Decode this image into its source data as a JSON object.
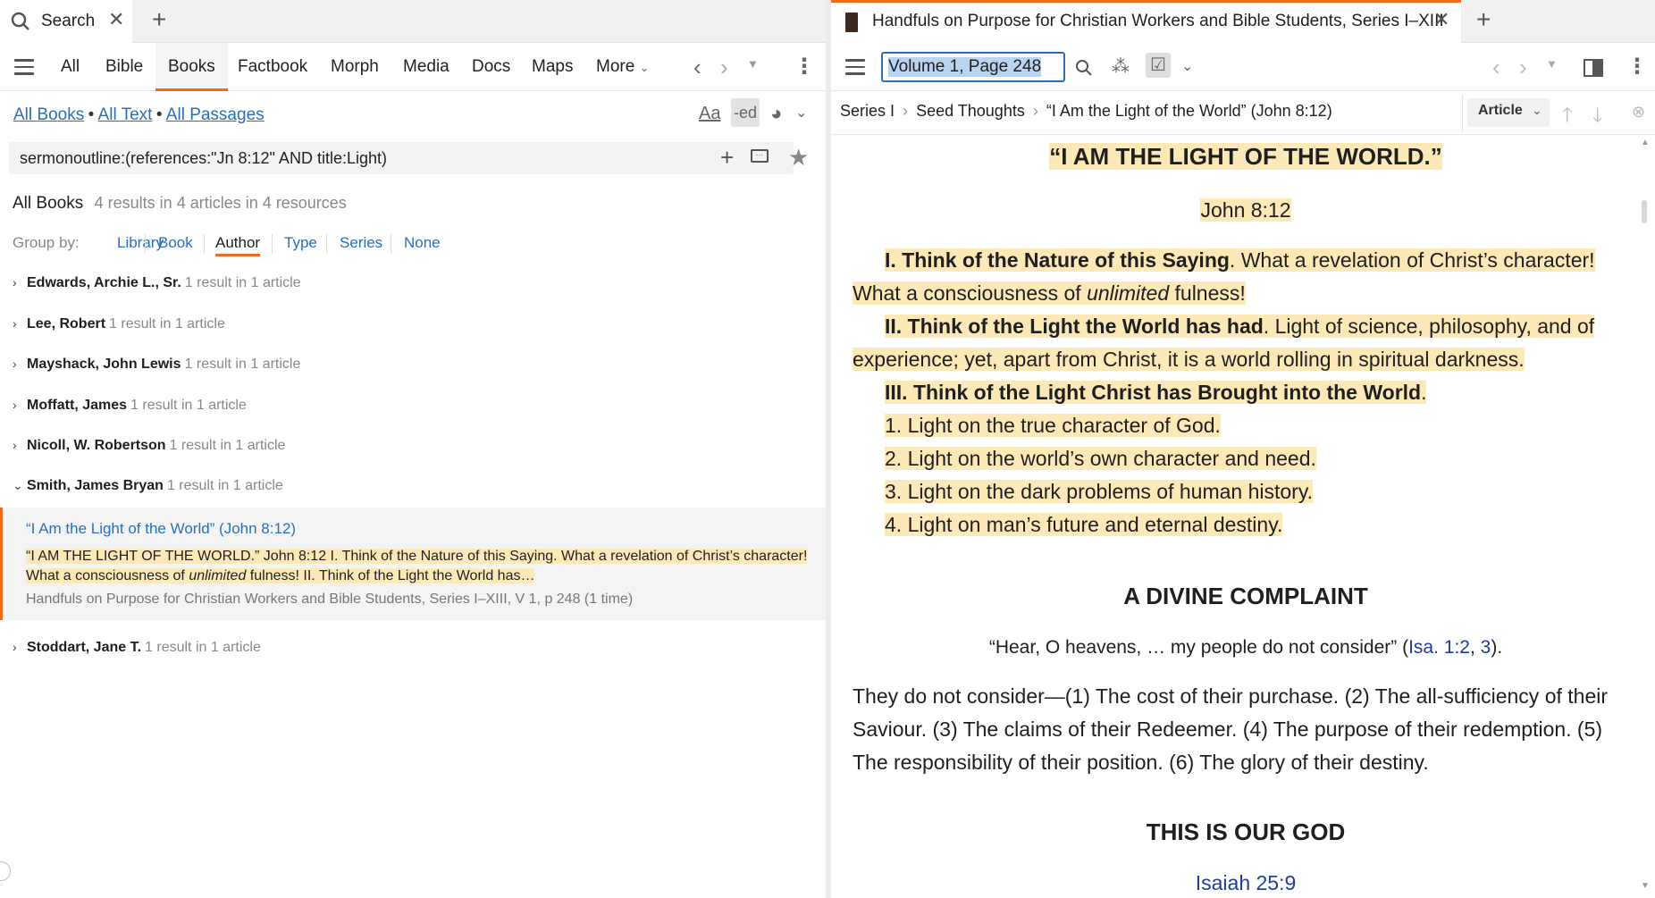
{
  "left": {
    "tab": {
      "title": "Search"
    },
    "toolbar": {
      "items": [
        "All",
        "Bible",
        "Books",
        "Factbook",
        "Morph",
        "Media",
        "Docs",
        "Maps",
        "More"
      ],
      "active": "Books"
    },
    "scope": {
      "all_books": "All Books",
      "all_text": "All Text",
      "all_passages": "All Passages"
    },
    "query": "sermonoutline:(references:\"Jn 8:12\" AND title:Light)",
    "summary": {
      "label": "All Books",
      "count": "4 results in 4 articles in 4 resources"
    },
    "group_by": {
      "label": "Group by:",
      "options": [
        "Library",
        "Book",
        "Author",
        "Type",
        "Series",
        "None"
      ],
      "active": "Author"
    },
    "authors": [
      {
        "name": "Edwards, Archie L., Sr.",
        "meta": "1 result in 1 article"
      },
      {
        "name": "Lee, Robert",
        "meta": "1 result in 1 article"
      },
      {
        "name": "Mayshack, John Lewis",
        "meta": "1 result in 1 article"
      },
      {
        "name": "Moffatt, James",
        "meta": "1 result in 1 article"
      },
      {
        "name": "Nicoll, W. Robertson",
        "meta": "1 result in 1 article"
      },
      {
        "name": "Smith, James Bryan",
        "meta": "1 result in 1 article"
      },
      {
        "name": "Stoddart, Jane T.",
        "meta": "1 result in 1 article"
      }
    ],
    "result": {
      "title": "“I Am the Light of the World” (John 8:12)",
      "snippet_1": "“I AM THE LIGHT OF THE WORLD.” John 8:12 I. Think of the Nature of this Saying. What a revelation of Christ’s character!",
      "snippet_2a": "What a consciousness of ",
      "snippet_2i": "unlimited",
      "snippet_2b": " fulness! II. Think of the Light the World has…",
      "source": "Handfuls on Purpose for Christian Workers and Bible Students, Series I–XIII, V 1, p 248 (1 time)"
    }
  },
  "right": {
    "tab": {
      "title": "Handfuls on Purpose for Christian Workers and Bible Students, Series I–XIII"
    },
    "location": "Volume 1, Page 248",
    "breadcrumb": [
      "Series I",
      "Seed Thoughts",
      "“I Am the Light of the World” (John 8:12)"
    ],
    "view_mode": "Article",
    "article": {
      "title": "“I AM THE LIGHT OF THE WORLD.”",
      "ref": "John 8:12",
      "p1_bold": "I. Think of the Nature of this Saying",
      "p1_a": ". What a revelation of Christ’s character!",
      "p1_b": "What a consciousness of ",
      "p1_i": "unlimited",
      "p1_c": " fulness!",
      "p2_bold": "II. Think of the Light the World has had",
      "p2_a": ". Light of science, philosophy, and of",
      "p2_b": "experience; yet, apart from Christ, it is a world rolling in spiritual darkness.",
      "p3_bold": "III. Think of the Light Christ has Brought into the World",
      "p3_a": ".",
      "list": [
        "1. Light on the true character of God.",
        "2. Light on the world’s own character and need.",
        "3. Light on the dark problems of human history.",
        "4. Light on man’s future and eternal destiny."
      ],
      "h2": "A DIVINE COMPLAINT",
      "quote_a": "“Hear, O heavens, … my people do not consider” (",
      "quote_link1": "Isa. 1:2",
      "quote_comma": ", ",
      "quote_link2": "3",
      "quote_b": ").",
      "para_lines": [
        "They do not consider—(1) The cost of their purchase. (2) The all-sufficiency of their",
        "Saviour. (3) The claims of their Redeemer. (4) The purpose of their redemption. (5)",
        "The responsibility of their position. (6) The glory of their destiny."
      ],
      "h3": "THIS IS OUR GOD",
      "h3_ref": "Isaiah 25:9"
    }
  },
  "colors": {
    "accent": "#f06a1d",
    "link": "#2a6fba",
    "highlight": "#fde9b8"
  }
}
